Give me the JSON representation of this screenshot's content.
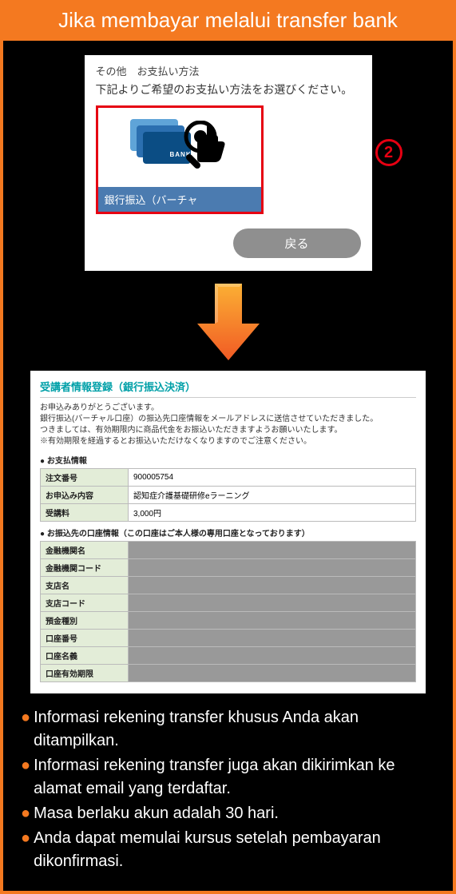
{
  "header": {
    "title": "Jika membayar melalui transfer bank"
  },
  "panel1": {
    "label": "その他　お支払い方法",
    "instruction": "下記よりご希望のお支払い方法をお選びください。",
    "bank_tag": "BANK",
    "tile_label": "銀行振込（バーチャ",
    "step_number": "2",
    "back_button": "戻る"
  },
  "panel2": {
    "title": "受講者情報登録（銀行振込決済）",
    "thanks_lines": [
      "お申込みありがとうございます。",
      "銀行振込(バーチャル口座）の振込先口座情報をメールアドレスに送信させていただきました。",
      "つきましては、有効期限内に商品代金をお振込いただきますようお願いいたします。",
      "※有効期限を経過するとお振込いただけなくなりますのでご注意ください。"
    ],
    "payment_header": "● お支払情報",
    "payment_rows": [
      {
        "label": "注文番号",
        "value": "900005754"
      },
      {
        "label": "お申込み内容",
        "value": "認知症介護基礎研修eラーニング"
      },
      {
        "label": "受講料",
        "value": "3,000円"
      }
    ],
    "bank_header": "● お振込先の口座情報（この口座はご本人様の専用口座となっております）",
    "bank_rows": [
      {
        "label": "金融機関名"
      },
      {
        "label": "金融機関コード"
      },
      {
        "label": "支店名"
      },
      {
        "label": "支店コード"
      },
      {
        "label": "預金種別"
      },
      {
        "label": "口座番号"
      },
      {
        "label": "口座名義"
      },
      {
        "label": "口座有効期限"
      }
    ]
  },
  "notes": [
    "Informasi rekening transfer khusus Anda akan ditampilkan.",
    "Informasi rekening transfer juga akan dikirimkan ke alamat email yang terdaftar.",
    "Masa berlaku akun adalah 30 hari.",
    "Anda dapat memulai kursus setelah pembayaran dikonfirmasi."
  ]
}
